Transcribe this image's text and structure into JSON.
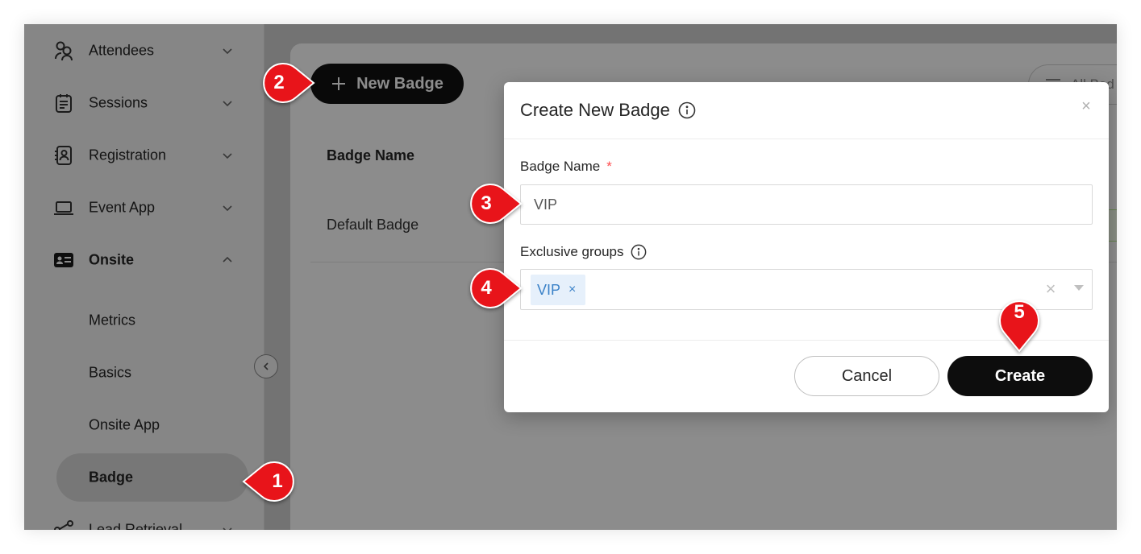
{
  "sidebar": {
    "items": [
      {
        "label": "Attendees",
        "icon": "attendees-icon",
        "expanded": false
      },
      {
        "label": "Sessions",
        "icon": "sessions-icon",
        "expanded": false
      },
      {
        "label": "Registration",
        "icon": "registration-icon",
        "expanded": false
      },
      {
        "label": "Event App",
        "icon": "laptop-icon",
        "expanded": false
      },
      {
        "label": "Onsite",
        "icon": "id-card-icon",
        "expanded": true
      },
      {
        "label": "Lead Retrieval",
        "icon": "share-icon",
        "expanded": false
      }
    ],
    "sub_items": [
      {
        "label": "Metrics"
      },
      {
        "label": "Basics"
      },
      {
        "label": "Onsite App"
      },
      {
        "label": "Badge",
        "active": true
      }
    ]
  },
  "main": {
    "new_badge_label": "New Badge",
    "filter_label": "All Bad",
    "table": {
      "columns": [
        "Badge Name"
      ],
      "rows": [
        [
          "Default Badge"
        ]
      ]
    }
  },
  "modal": {
    "title": "Create New Badge",
    "fields": {
      "badge_name": {
        "label": "Badge Name",
        "required_mark": "*",
        "value": "VIP"
      },
      "exclusive_groups": {
        "label": "Exclusive groups",
        "tags": [
          "VIP"
        ]
      }
    },
    "close_symbol": "×",
    "tag_remove_symbol": "×",
    "clear_symbol": "×",
    "cancel_label": "Cancel",
    "create_label": "Create"
  },
  "markers": [
    "1",
    "2",
    "3",
    "4",
    "5"
  ],
  "colors": {
    "marker_red": "#e8141a",
    "primary_button": "#0d0d0d",
    "tag_bg": "#e6f0fb",
    "tag_text": "#3b82c8",
    "required": "#ff4d4f"
  }
}
